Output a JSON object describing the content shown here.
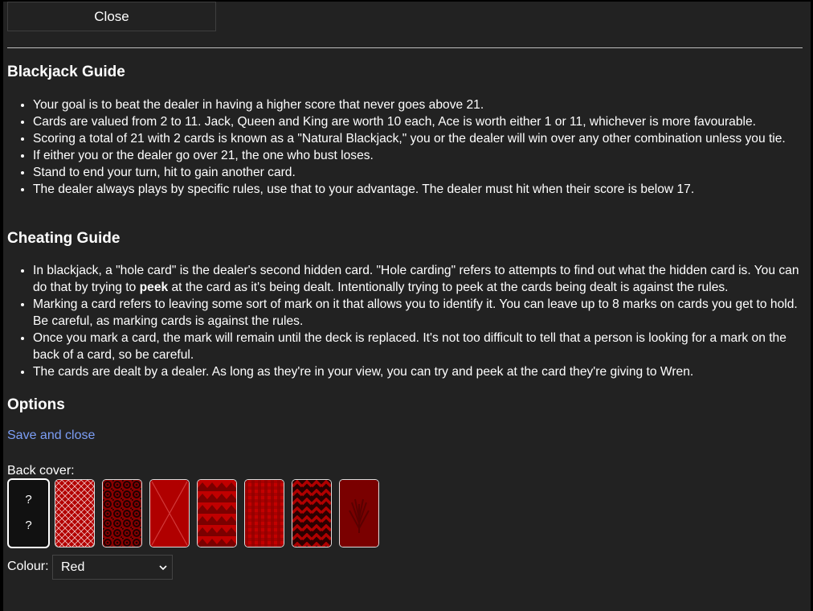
{
  "header": {
    "close_label": "Close"
  },
  "blackjack_guide": {
    "title": "Blackjack Guide",
    "items": [
      "Your goal is to beat the dealer in having a higher score that never goes above 21.",
      "Cards are valued from 2 to 11. Jack, Queen and King are worth 10 each, Ace is worth either 1 or 11, whichever is more favourable.",
      "Scoring a total of 21 with 2 cards is known as a \"Natural Blackjack,\" you or the dealer will win over any other combination unless you tie.",
      "If either you or the dealer go over 21, the one who bust loses.",
      "Stand to end your turn, hit to gain another card.",
      "The dealer always plays by specific rules, use that to your advantage. The dealer must hit when their score is below 17."
    ]
  },
  "cheating_guide": {
    "title": "Cheating Guide",
    "item1_before": "In blackjack, a \"hole card\" is the dealer's second hidden card. \"Hole carding\" refers to attempts to find out what the hidden card is. You can do that by trying to ",
    "item1_bold": "peek",
    "item1_after": " at the card as it's being dealt. Intentionally trying to peek at the cards being dealt is against the rules.",
    "items": [
      "Marking a card refers to leaving some sort of mark on it that allows you to identify it. You can leave up to 8 marks on cards you get to hold. Be careful, as marking cards is against the rules.",
      "Once you mark a card, the mark will remain until the deck is replaced. It's not too difficult to tell that a person is looking for a mark on the back of a card, so be careful.",
      "The cards are dealt by a dealer. As long as they're in your view, you can try and peek at the card they're giving to Wren."
    ]
  },
  "options": {
    "title": "Options",
    "save_label": "Save and close",
    "back_cover_label": "Back cover:",
    "selected_card_marks": [
      "?",
      "?"
    ],
    "card_patterns": [
      "unknown",
      "diamond-lattice",
      "ornate-circles",
      "diagonal-cross",
      "zigzag-bands",
      "plaid",
      "chevron",
      "feather"
    ],
    "colour_label": "Colour:",
    "colour_value": "Red",
    "accent_red": "#b30000",
    "link_color": "#7c9ef5"
  }
}
